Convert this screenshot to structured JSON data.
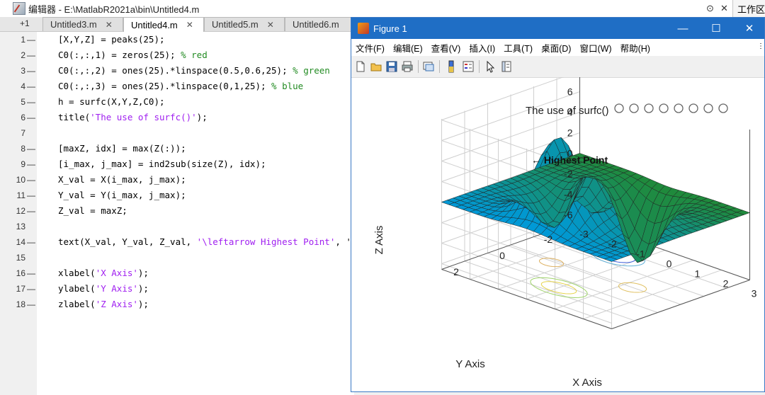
{
  "editor": {
    "title": "编辑器 - E:\\MatlabR2021a\\bin\\Untitled4.m",
    "workspace_label": "工作区",
    "tab_plus": "+1",
    "tabs": [
      {
        "label": "Untitled3.m",
        "active": false
      },
      {
        "label": "Untitled4.m",
        "active": true
      },
      {
        "label": "Untitled5.m",
        "active": false
      },
      {
        "label": "Untitled6.m",
        "active": false
      }
    ],
    "lines": [
      {
        "n": "1",
        "dash": "—",
        "code": "[X,Y,Z] = peaks(25);"
      },
      {
        "n": "2",
        "dash": "—",
        "code": "C0(:,:,1) = zeros(25); ",
        "comment": "% red"
      },
      {
        "n": "3",
        "dash": "—",
        "code": "C0(:,:,2) = ones(25).*linspace(0.5,0.6,25); ",
        "comment": "% green"
      },
      {
        "n": "4",
        "dash": "—",
        "code": "C0(:,:,3) = ones(25).*linspace(0,1,25); ",
        "comment": "% blue"
      },
      {
        "n": "5",
        "dash": "—",
        "code": "h = surfc(X,Y,Z,C0);"
      },
      {
        "n": "6",
        "dash": "—",
        "code": "title(",
        "str": "'The use of surfc()'",
        "code2": ");"
      },
      {
        "n": "7",
        "dash": "",
        "code": ""
      },
      {
        "n": "8",
        "dash": "—",
        "code": "[maxZ, idx] = max(Z(:));"
      },
      {
        "n": "9",
        "dash": "—",
        "code": "[i_max, j_max] = ind2sub(size(Z), idx);"
      },
      {
        "n": "10",
        "dash": "—",
        "code": "X_val = X(i_max, j_max);"
      },
      {
        "n": "11",
        "dash": "—",
        "code": "Y_val = Y(i_max, j_max);"
      },
      {
        "n": "12",
        "dash": "—",
        "code": "Z_val = maxZ;"
      },
      {
        "n": "13",
        "dash": "",
        "code": ""
      },
      {
        "n": "14",
        "dash": "—",
        "code": "text(X_val, Y_val, Z_val, ",
        "str": "'\\leftarrow Highest Point'",
        "code2": ", '"
      },
      {
        "n": "15",
        "dash": "",
        "code": ""
      },
      {
        "n": "16",
        "dash": "—",
        "code": "xlabel(",
        "str": "'X Axis'",
        "code2": ");"
      },
      {
        "n": "17",
        "dash": "—",
        "code": "ylabel(",
        "str": "'Y Axis'",
        "code2": ");"
      },
      {
        "n": "18",
        "dash": "—",
        "code": "zlabel(",
        "str": "'Z Axis'",
        "code2": ");"
      }
    ]
  },
  "figure": {
    "title": "Figure 1",
    "controls": {
      "minimize": "—",
      "maximize": "☐",
      "close": "✕"
    },
    "menu": [
      "文件(F)",
      "编辑(E)",
      "查看(V)",
      "插入(I)",
      "工具(T)",
      "桌面(D)",
      "窗口(W)",
      "帮助(H)"
    ],
    "toolbar_icons": [
      "new-figure-icon",
      "open-file-icon",
      "save-icon",
      "print-icon",
      "link-plot-icon",
      "colorbar-icon",
      "legend-icon",
      "pointer-icon",
      "property-inspector-icon"
    ],
    "axes_toolbar_icons": [
      "brush-icon",
      "data-tips-icon",
      "export-icon",
      "rotate-icon",
      "pan-icon",
      "zoom-in-icon",
      "zoom-out-icon",
      "home-icon"
    ]
  },
  "chart_data": {
    "type": "surface",
    "title": "The use of surfc()",
    "xlabel": "X Axis",
    "ylabel": "Y Axis",
    "zlabel": "Z Axis",
    "annotation": "← Highest Point",
    "xticks": [
      "-3",
      "-2",
      "-1",
      "0",
      "1",
      "2",
      "3"
    ],
    "yticks": [
      "-2",
      "0",
      "2"
    ],
    "zticks": [
      "6",
      "4",
      "2",
      "0",
      "-2",
      "-4",
      "-6"
    ],
    "xlim": [
      -3,
      3
    ],
    "ylim": [
      -3,
      3
    ],
    "zlim": [
      -6.55,
      8.1
    ],
    "grid": true,
    "colors": {
      "surface_green": "#1f8a3c",
      "surface_blue": "#1f8fd6",
      "mesh": "#222222"
    }
  }
}
